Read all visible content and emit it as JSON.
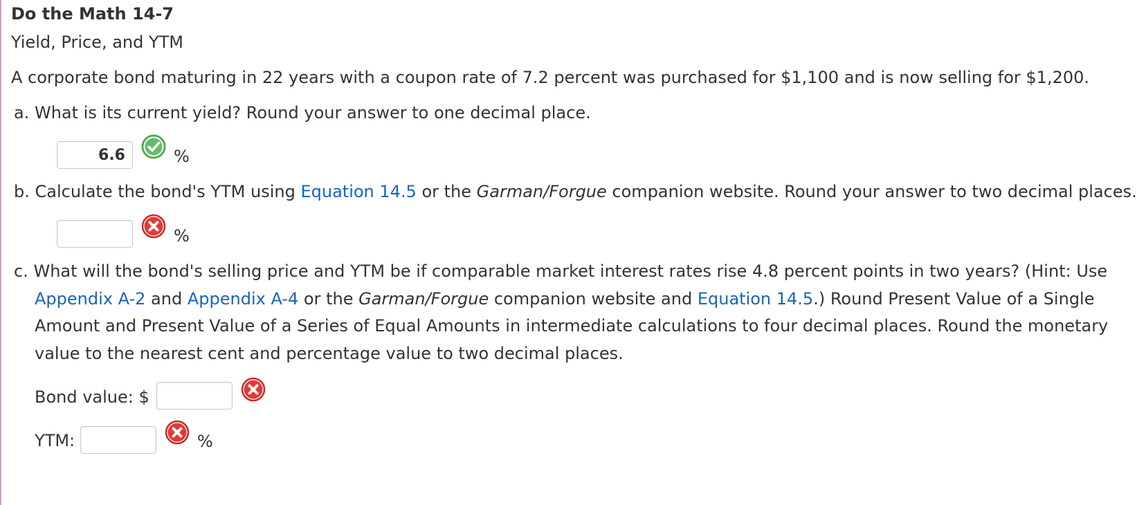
{
  "header": {
    "title": "Do the Math 14-7",
    "subtitle": "Yield, Price, and YTM"
  },
  "problem": {
    "statement": "A corporate bond maturing in 22 years with a coupon rate of 7.2 percent was purchased for $1,100 and is now selling for $1,200."
  },
  "part_a": {
    "letter": "a.",
    "question": "What is its current yield? Round your answer to one decimal place.",
    "answer_value": "6.6",
    "status": "correct",
    "unit": "%"
  },
  "part_b": {
    "letter": "b.",
    "text_1": "Calculate the bond's YTM using ",
    "link_equation": "Equation 14.5",
    "text_2": " or the ",
    "italic_site": "Garman/Forgue",
    "text_3": " companion website. Round your answer to two decimal places.",
    "answer_value": "",
    "status": "incorrect",
    "unit": "%"
  },
  "part_c": {
    "letter": "c.",
    "line1": "What will the bond's selling price and YTM be if comparable market interest rates rise 4.8 percent points in two years? (Hint: Use",
    "link_appendix_a2": "Appendix A-2",
    "and_1": " and ",
    "link_appendix_a4": "Appendix A-4",
    "or_the": " or the ",
    "italic_site": "Garman/Forgue",
    "companion_and": " companion website and ",
    "link_equation": "Equation 14.5",
    "after_equation": ".) Round Present Value of a Single",
    "line3": "Amount and Present Value of a Series of Equal Amounts in intermediate calculations to four decimal places. Round the monetary",
    "line4": "value to the nearest cent and percentage value to two decimal places.",
    "bond_value_label": "Bond value: $",
    "bond_value_answer": "",
    "bond_value_status": "incorrect",
    "ytm_label": "YTM:",
    "ytm_answer": "",
    "ytm_status": "incorrect",
    "ytm_unit": "%"
  },
  "colors": {
    "text": "#333333",
    "link": "#1565c0",
    "correct": "#4caf50",
    "incorrect": "#d32f2f",
    "left_rule": "#c9a0c9"
  },
  "icons": {
    "correct": "checkmark-circle-icon",
    "incorrect": "x-circle-icon"
  }
}
